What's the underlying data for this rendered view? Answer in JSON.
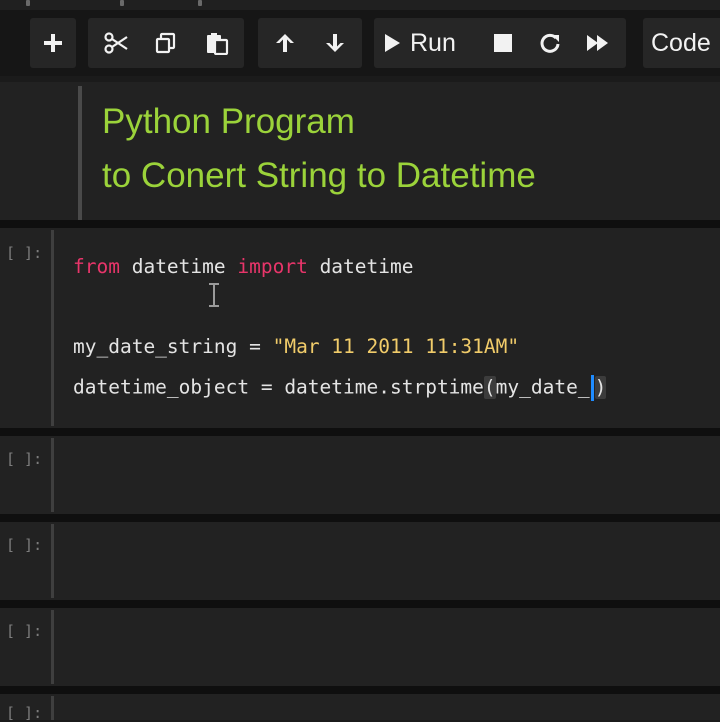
{
  "toolbar": {
    "buttons": [
      {
        "name": "insert-cell-button",
        "icon": "plus-icon"
      },
      {
        "name": "cut-button",
        "icon": "scissors-icon"
      },
      {
        "name": "copy-button",
        "icon": "copy-icon"
      },
      {
        "name": "paste-button",
        "icon": "paste-icon"
      },
      {
        "name": "move-up-button",
        "icon": "arrow-up-icon"
      },
      {
        "name": "move-down-button",
        "icon": "arrow-down-icon"
      },
      {
        "name": "interrupt-button",
        "icon": "stop-icon"
      },
      {
        "name": "restart-button",
        "icon": "restart-icon"
      },
      {
        "name": "restart-run-all-button",
        "icon": "fast-forward-icon"
      }
    ],
    "run_label": "Run",
    "cell_type": "Code"
  },
  "markdown_cell": {
    "line1": "Python Program",
    "line2": "to Conert String to Datetime"
  },
  "code_cells": [
    {
      "prompt": "[ ]:",
      "lines": {
        "l1": {
          "kw1": "from",
          "mod": " datetime ",
          "kw2": "import",
          "name": " datetime"
        },
        "l2": {
          "var": "my_date_string = ",
          "str": "\"Mar 11 2011 11:31AM\""
        },
        "l3": {
          "pre": "datetime_object = datetime.strptime",
          "open": "(",
          "arg": "my_date_",
          "close": ")"
        }
      }
    },
    {
      "prompt": "[ ]:"
    },
    {
      "prompt": "[ ]:"
    },
    {
      "prompt": "[ ]:"
    },
    {
      "prompt": "[ ]:"
    }
  ],
  "colors": {
    "background": "#1b1b1b",
    "cell": "#222222",
    "markdown_heading": "#9bd33a",
    "keyword": "#e8356a",
    "string": "#f1cc6a",
    "cursor": "#1f8cff"
  }
}
